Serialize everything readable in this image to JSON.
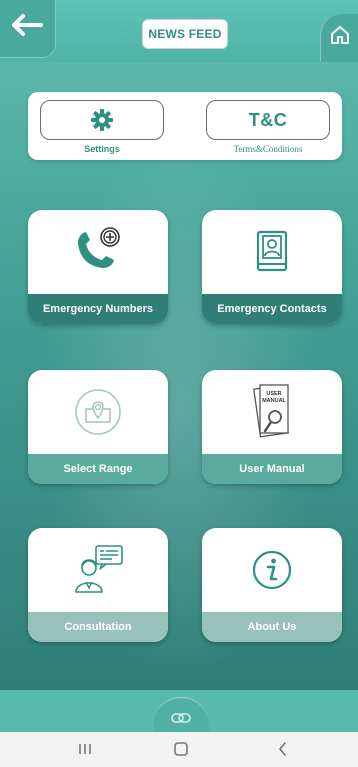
{
  "header": {
    "news_feed_label": "NEWS FEED",
    "back_icon": "arrow-left-icon",
    "home_icon": "home-icon"
  },
  "settings": {
    "settings_label": "Settings",
    "tc_button_text": "T&C",
    "tc_label": "Terms&Conditions"
  },
  "tiles": [
    {
      "label": "Emergency Numbers",
      "icon": "phone-plus-icon"
    },
    {
      "label": "Emergency Contacts",
      "icon": "contact-book-icon"
    },
    {
      "label": "Select Range",
      "icon": "map-pin-icon"
    },
    {
      "label": "User Manual",
      "icon": "user-manual-icon"
    },
    {
      "label": "Consultation",
      "icon": "consultation-icon"
    },
    {
      "label": "About Us",
      "icon": "info-icon"
    }
  ],
  "user_manual_icon_text": "USER MANUAL",
  "colors": {
    "primary": "#4fb3a6",
    "dark": "#2f7e78",
    "accent_text": "#2e8f83",
    "white": "#ffffff"
  }
}
